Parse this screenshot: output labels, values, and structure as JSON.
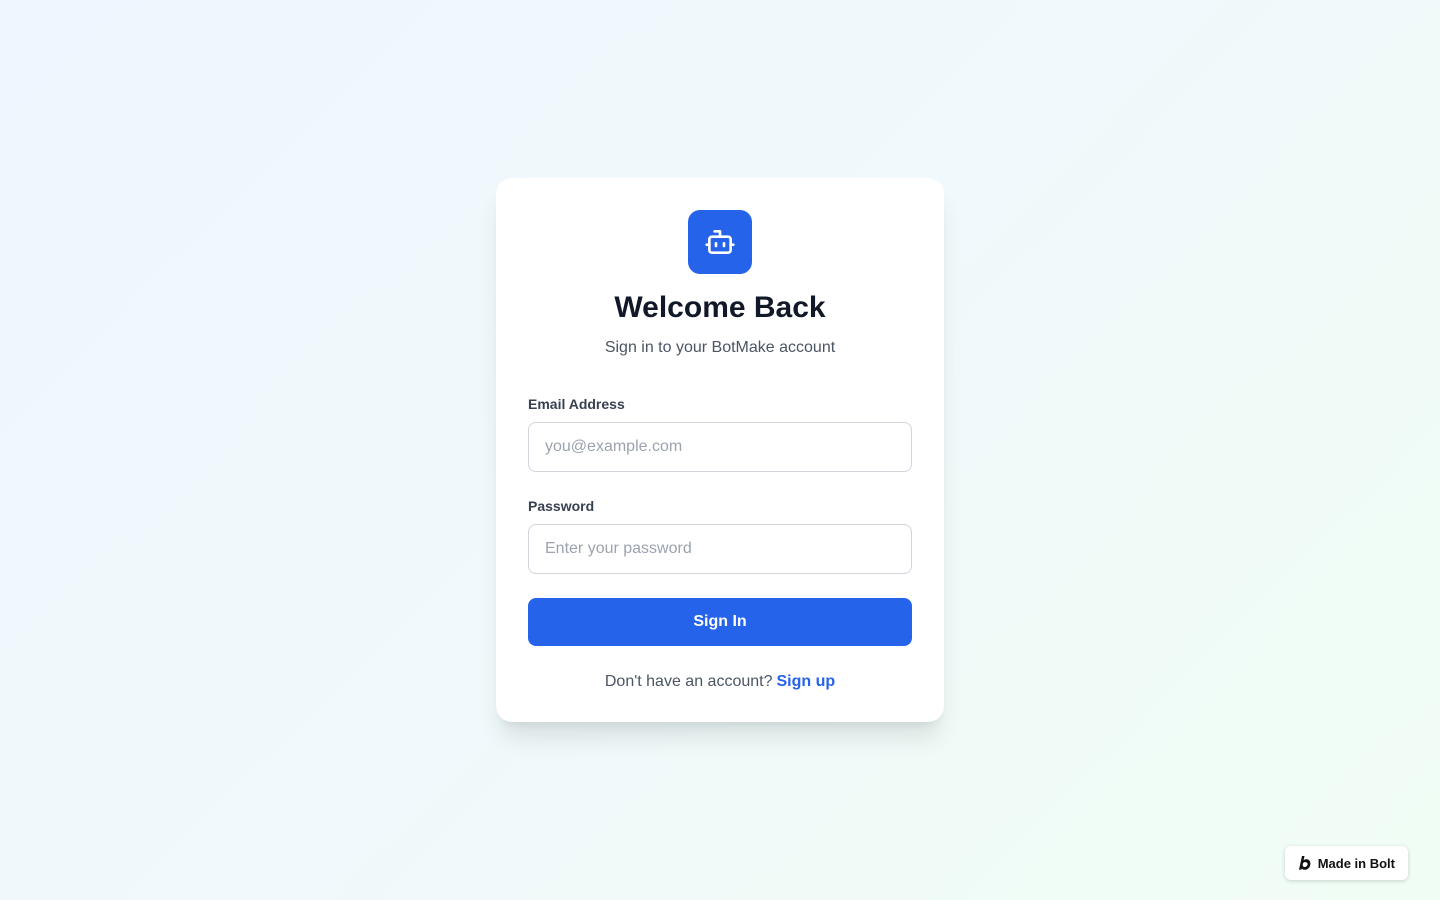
{
  "login": {
    "title": "Welcome Back",
    "subtitle": "Sign in to your BotMake account",
    "logo_icon": "robot-icon",
    "email": {
      "label": "Email Address",
      "placeholder": "you@example.com",
      "value": ""
    },
    "password": {
      "label": "Password",
      "placeholder": "Enter your password",
      "value": ""
    },
    "submit_label": "Sign In",
    "footer_text": "Don't have an account?",
    "signup_label": "Sign up"
  },
  "badge": {
    "icon": "bolt-logo-icon",
    "label": "Made in Bolt"
  },
  "colors": {
    "accent": "#2563eb",
    "title": "#111827",
    "muted": "#4b5563"
  }
}
